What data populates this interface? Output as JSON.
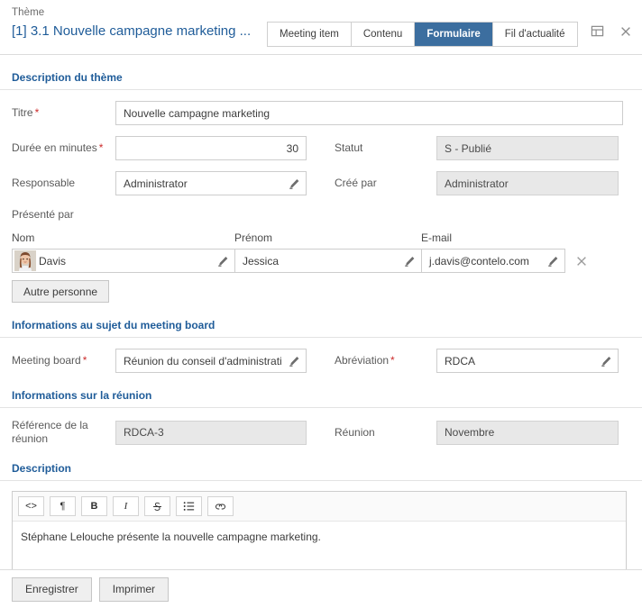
{
  "header": {
    "eyebrow": "Thème",
    "title": "[1] 3.1 Nouvelle campagne marketing ...",
    "tabs": [
      {
        "label": "Meeting item",
        "active": false
      },
      {
        "label": "Contenu",
        "active": false
      },
      {
        "label": "Formulaire",
        "active": true
      },
      {
        "label": "Fil d'actualité",
        "active": false
      }
    ],
    "icons": [
      {
        "name": "panel-layout-icon"
      },
      {
        "name": "close-icon"
      }
    ],
    "active_tab_color": "#3c6e9f",
    "title_color": "#1f5c99"
  },
  "sections": {
    "theme": {
      "title": "Description du thème",
      "titre": {
        "label": "Titre",
        "required": true,
        "value": "Nouvelle campagne marketing"
      },
      "duree": {
        "label": "Durée en minutes",
        "required": true,
        "value": "30"
      },
      "statut": {
        "label": "Statut",
        "required": false,
        "value": "S - Publié",
        "readonly": true
      },
      "responsable": {
        "label": "Responsable",
        "required": false,
        "value": "Administrator",
        "pencil": true
      },
      "cree_par": {
        "label": "Créé par",
        "required": false,
        "value": "Administrator",
        "readonly": true
      }
    },
    "presente_par": {
      "label": "Présenté par",
      "columns": [
        "Nom",
        "Prénom",
        "E-mail"
      ],
      "rows": [
        {
          "nom": "Davis",
          "prenom": "Jessica",
          "email": "j.davis@contelo.com"
        }
      ],
      "add_button": "Autre personne"
    },
    "meeting_board": {
      "title": "Informations au sujet du meeting board",
      "board": {
        "label": "Meeting board",
        "required": true,
        "value": "Réunion du conseil d'administrati",
        "pencil": true
      },
      "abreviation": {
        "label": "Abréviation",
        "required": true,
        "value": "RDCA",
        "pencil": true
      }
    },
    "reunion": {
      "title": "Informations sur la réunion",
      "reference": {
        "label": "Référence de la réunion",
        "value": "RDCA-3",
        "readonly": true
      },
      "reunion": {
        "label": "Réunion",
        "value": "Novembre",
        "readonly": true
      }
    },
    "description": {
      "title": "Description",
      "toolbar": [
        {
          "name": "source-code-icon",
          "glyph": "<>"
        },
        {
          "name": "paragraph-icon",
          "glyph": "¶"
        },
        {
          "name": "bold-icon",
          "glyph": "B"
        },
        {
          "name": "italic-icon",
          "glyph": "I"
        },
        {
          "name": "strikethrough-icon",
          "glyph": "S"
        },
        {
          "name": "bullet-list-icon",
          "glyph": "list"
        },
        {
          "name": "link-icon",
          "glyph": "link"
        }
      ],
      "content": "Stéphane Lelouche présente la nouvelle campagne marketing."
    }
  },
  "footer": {
    "save": "Enregistrer",
    "print": "Imprimer"
  }
}
